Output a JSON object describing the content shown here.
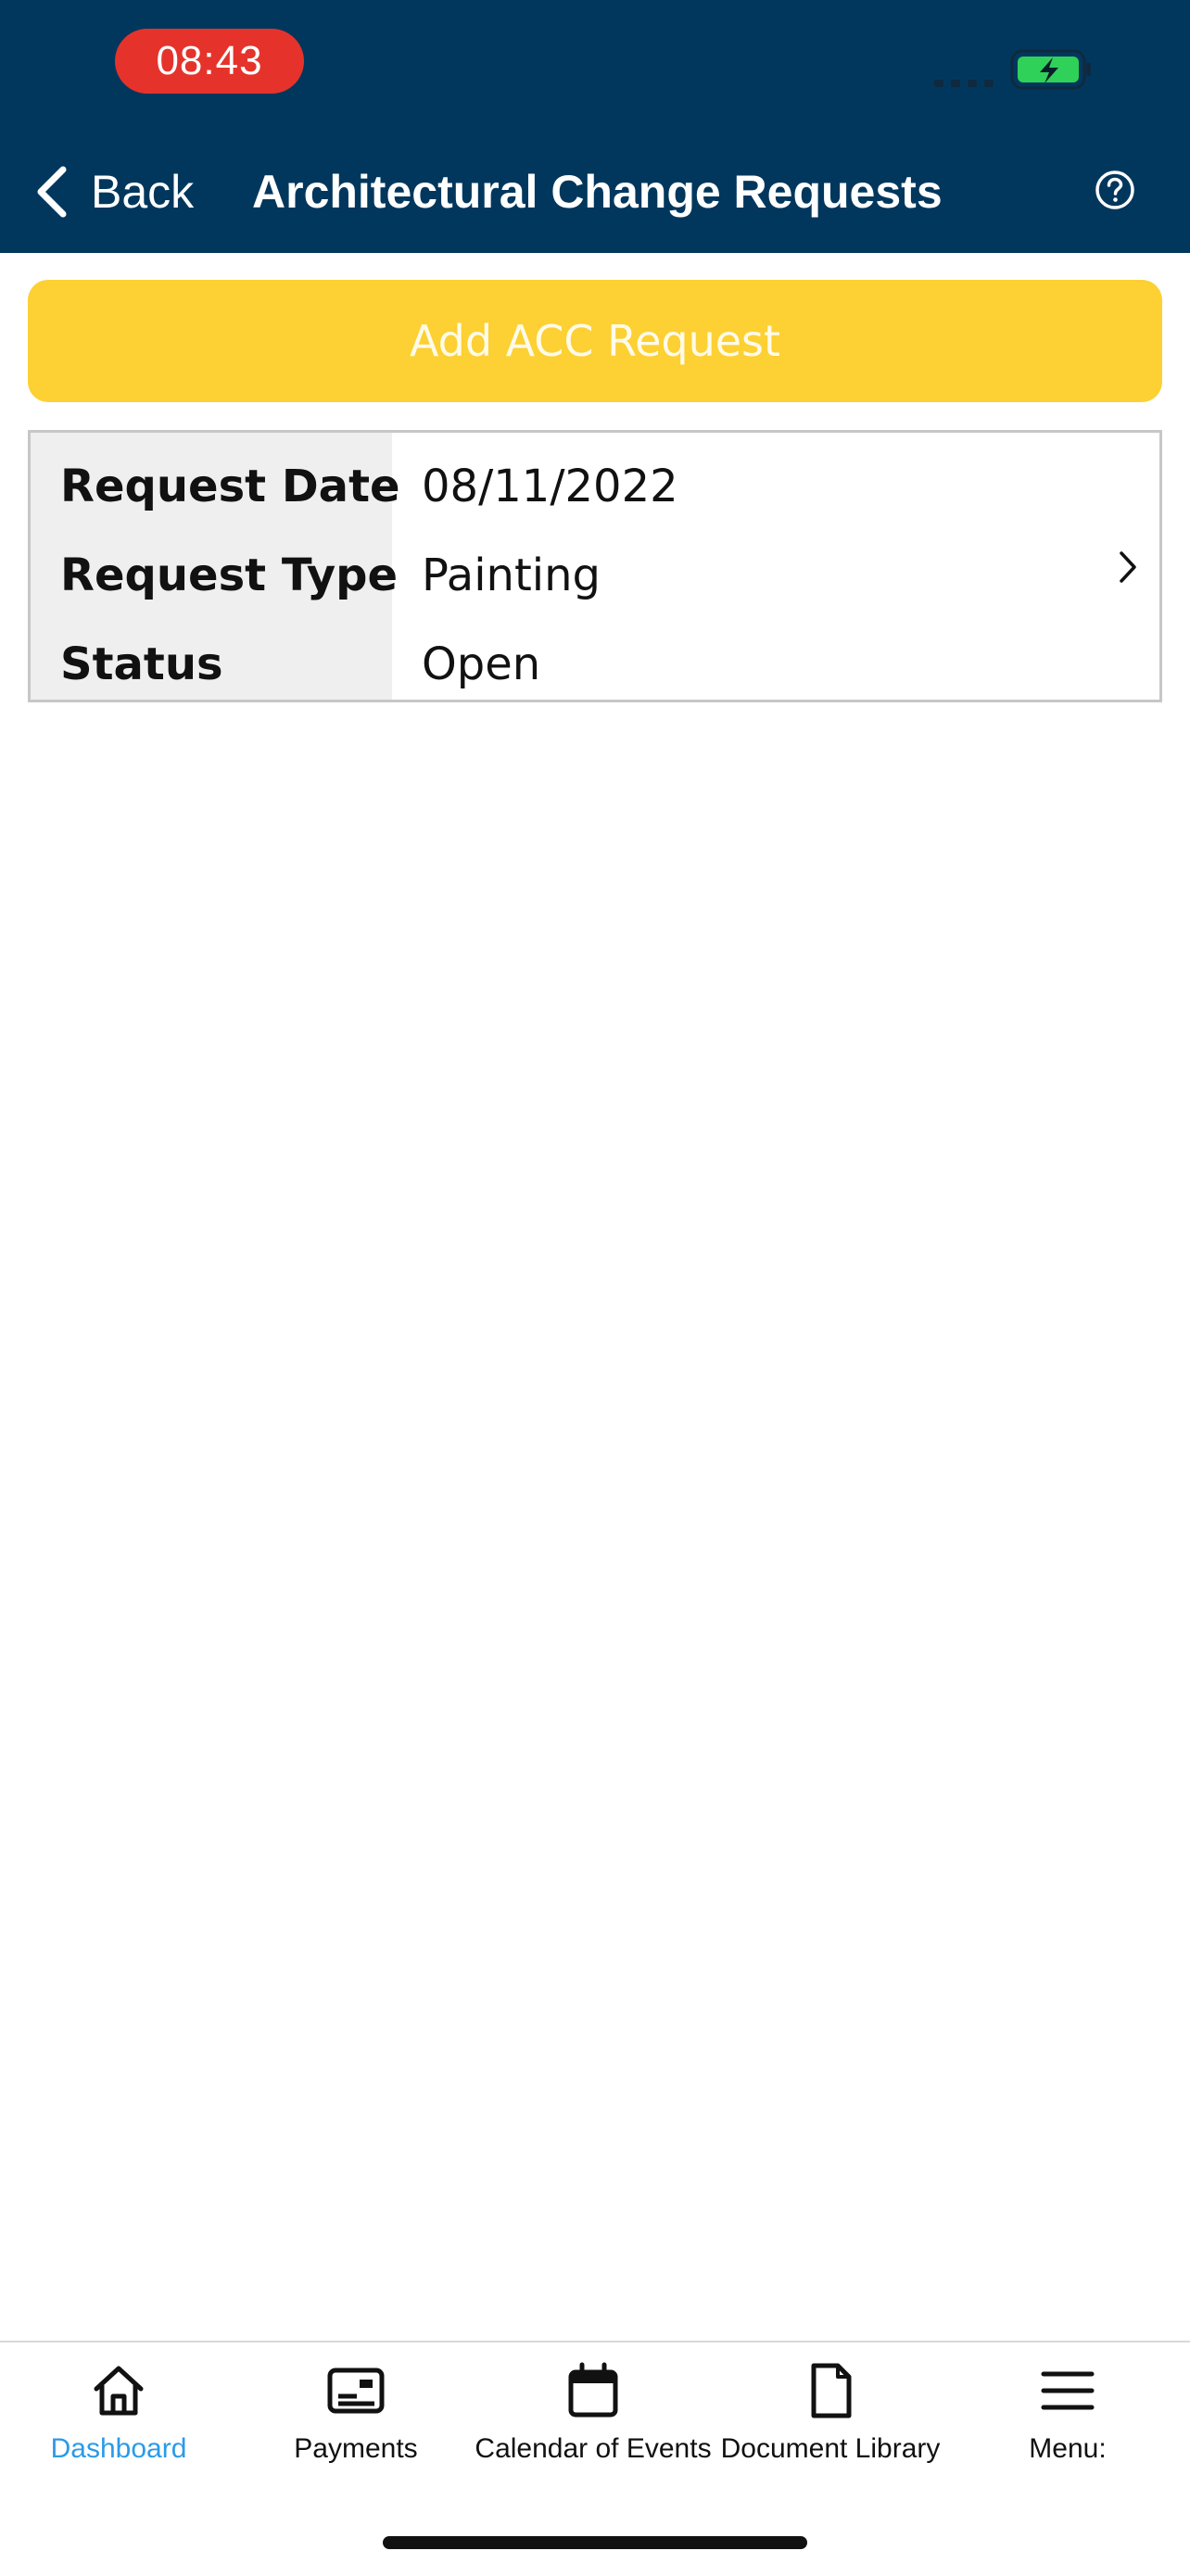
{
  "status_bar": {
    "time": "08:43"
  },
  "header": {
    "back_label": "Back",
    "title": "Architectural Change Requests",
    "help_icon": "question-circle-icon"
  },
  "add_button": {
    "label": "Add ACC Request"
  },
  "request": {
    "fields": [
      {
        "label": "Request Date",
        "value": "08/11/2022"
      },
      {
        "label": "Request Type",
        "value": "Painting"
      },
      {
        "label": "Status",
        "value": "Open"
      }
    ]
  },
  "tab_bar": {
    "tabs": [
      {
        "label": "Dashboard",
        "icon": "home-icon",
        "active": true
      },
      {
        "label": "Payments",
        "icon": "payment-card-icon",
        "active": false
      },
      {
        "label": "Calendar of Events",
        "icon": "calendar-icon",
        "active": false
      },
      {
        "label": "Document Library",
        "icon": "document-icon",
        "active": false
      },
      {
        "label": "Menu:",
        "icon": "hamburger-menu-icon",
        "active": false
      }
    ]
  },
  "colors": {
    "header_bg": "#02375d",
    "accent_yellow": "#fdd033",
    "active_tab": "#2b9ae8",
    "time_pill": "#e5332b",
    "battery": "#2fd158"
  }
}
